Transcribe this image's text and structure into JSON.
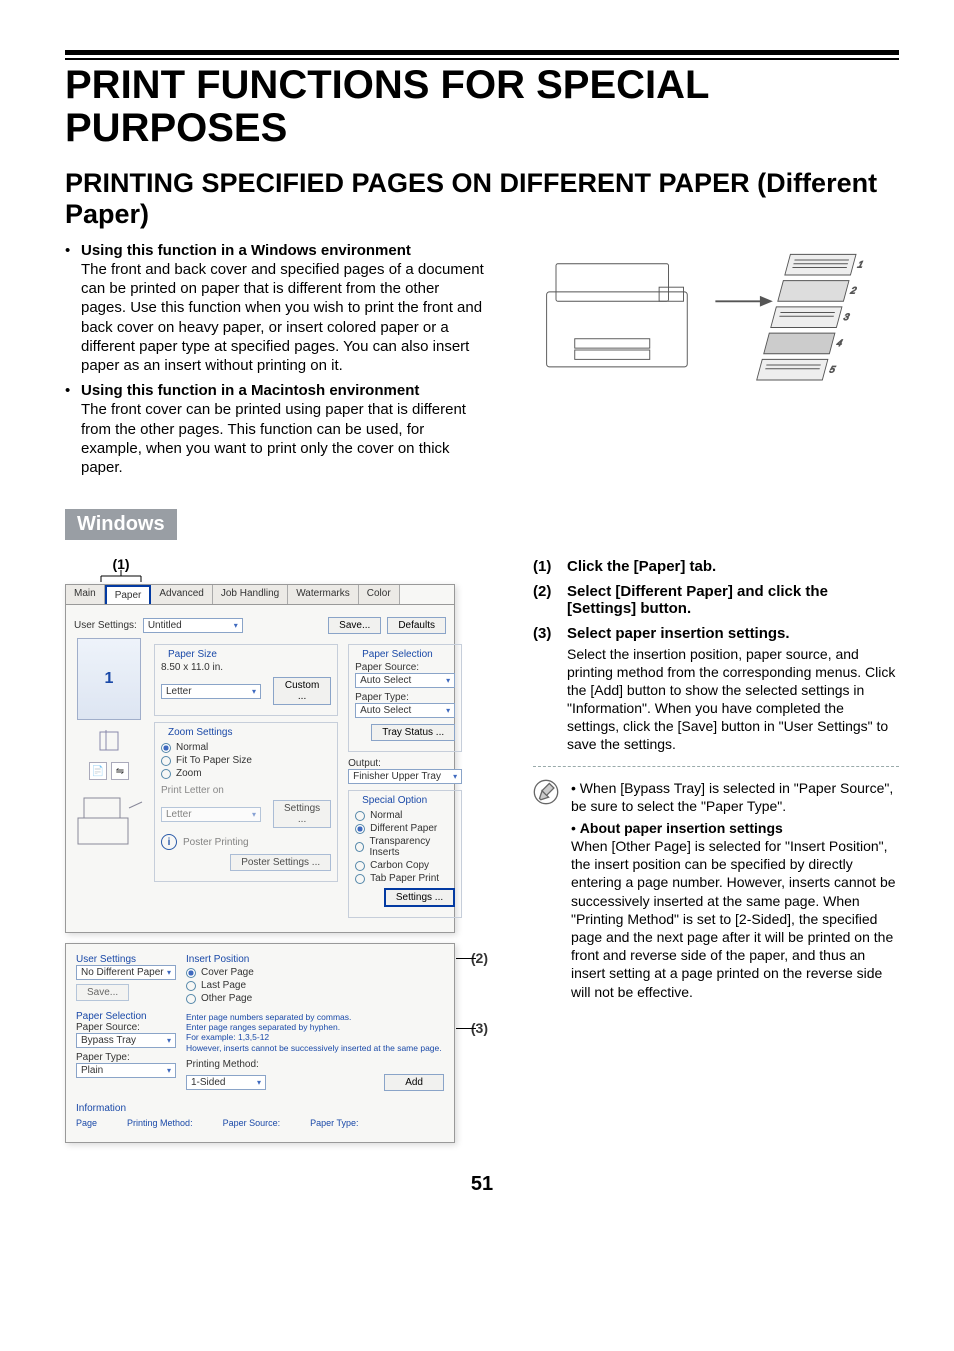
{
  "page_number": "51",
  "page_title": "PRINT FUNCTIONS FOR SPECIAL PURPOSES",
  "section_title": "PRINTING SPECIFIED PAGES ON DIFFERENT PAPER (Different Paper)",
  "bullets": [
    {
      "title": "Using this function in a Windows environment",
      "body": "The front and back cover and specified pages of a document can be printed on paper that is different from the other pages. Use this function when you wish to print the front and back cover on heavy paper, or insert colored paper or a different paper type at specified pages. You can also insert paper as an insert without printing on it."
    },
    {
      "title": "Using this function in a Macintosh environment",
      "body": "The front cover can be printed using paper that is different from the other pages. This function can be used, for example, when you want to print only the cover on thick paper."
    }
  ],
  "platform_label": "Windows",
  "callouts": {
    "one": "(1)",
    "two": "(2)",
    "three": "(3)"
  },
  "dlg1": {
    "tabs": {
      "main": "Main",
      "paper": "Paper",
      "advanced": "Advanced",
      "job": "Job Handling",
      "wm": "Watermarks",
      "color": "Color"
    },
    "user_settings_lbl": "User Settings:",
    "user_settings_val": "Untitled",
    "save_btn": "Save...",
    "defaults_btn": "Defaults",
    "paper_size_legend": "Paper Size",
    "paper_size_dim": "8.50 x 11.0 in.",
    "paper_size_val": "Letter",
    "custom_btn": "Custom ...",
    "zoom_legend": "Zoom Settings",
    "zoom_normal": "Normal",
    "zoom_fit": "Fit To Paper Size",
    "zoom_zoom": "Zoom",
    "print_letter_on": "Print Letter on",
    "print_letter_val": "Letter",
    "settings_btn": "Settings ...",
    "poster_chk": "Poster Printing",
    "poster_btn": "Poster Settings ...",
    "ps_legend": "Paper Selection",
    "ps_source": "Paper Source:",
    "ps_source_val": "Auto Select",
    "ps_type": "Paper Type:",
    "ps_type_val": "Auto Select",
    "tray_btn": "Tray Status ...",
    "output_lbl": "Output:",
    "output_val": "Finisher Upper Tray",
    "so_legend": "Special Option",
    "so_normal": "Normal",
    "so_diff": "Different Paper",
    "so_trans": "Transparency Inserts",
    "so_carbon": "Carbon Copy",
    "so_tab": "Tab Paper Print",
    "so_settings": "Settings ...",
    "prev_num": "1"
  },
  "dlg2": {
    "us_legend": "User Settings",
    "us_val": "No Different Paper",
    "us_save": "Save...",
    "ip_legend": "Insert Position",
    "ip_cover": "Cover Page",
    "ip_last": "Last Page",
    "ip_other": "Other Page",
    "ip_hint1": "Enter page numbers separated by commas.",
    "ip_hint2": "Enter page ranges separated by hyphen.",
    "ip_hint3": "For example:      1,3,5-12",
    "ip_hint4": "However, inserts cannot be successively inserted at the same page.",
    "ps_legend": "Paper Selection",
    "ps_source": "Paper Source:",
    "ps_source_val": "Bypass Tray",
    "ps_type": "Paper Type:",
    "ps_type_val": "Plain",
    "pm_lbl": "Printing Method:",
    "pm_val": "1-Sided",
    "add_btn": "Add",
    "info_legend": "Information",
    "info_page": "Page",
    "info_pm": "Printing Method:",
    "info_ps": "Paper Source:",
    "info_pt": "Paper Type:"
  },
  "steps": [
    {
      "num": "(1)",
      "title": "Click the [Paper] tab."
    },
    {
      "num": "(2)",
      "title": "Select [Different Paper] and click the [Settings] button."
    },
    {
      "num": "(3)",
      "title": "Select paper insertion settings.",
      "note": "Select the insertion position, paper source, and printing method from the corresponding menus. Click the [Add] button to show the selected settings in \"Information\". When you have completed the settings, click the [Save] button in \"User Settings\" to save the settings."
    }
  ],
  "tips": {
    "a": "When [Bypass Tray] is selected in \"Paper Source\", be sure to select the \"Paper Type\".",
    "b_title": "About paper insertion settings",
    "b_body": "When [Other Page] is selected for \"Insert Position\", the insert position can be specified by directly entering a page number. However, inserts cannot be successively inserted at the same page. When \"Printing Method\" is set to [2-Sided], the specified page and the next page after it will be printed on the front and reverse side of the paper, and thus an insert setting at a page printed on the reverse side will not be effective."
  }
}
